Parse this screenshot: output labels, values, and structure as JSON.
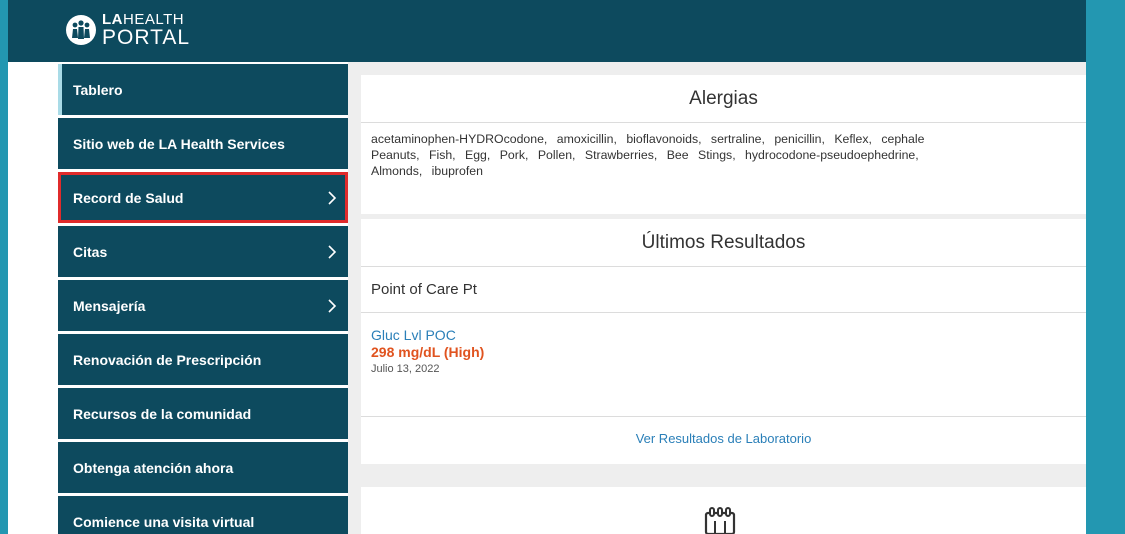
{
  "header": {
    "logo_top_bold": "LA",
    "logo_top_rest": "HEALTH",
    "logo_bottom": "PORTAL"
  },
  "sidebar": {
    "items": [
      {
        "label": "Tablero",
        "chevron": false
      },
      {
        "label": "Sitio web de LA Health Services",
        "chevron": false
      },
      {
        "label": "Record de Salud",
        "chevron": true
      },
      {
        "label": "Citas",
        "chevron": true
      },
      {
        "label": "Mensajería",
        "chevron": true
      },
      {
        "label": "Renovación de Prescripción",
        "chevron": false
      },
      {
        "label": "Recursos de la comunidad",
        "chevron": false
      },
      {
        "label": "Obtenga atención ahora",
        "chevron": false
      },
      {
        "label": "Comience una visita virtual",
        "chevron": false
      }
    ]
  },
  "allergies": {
    "title": "Alergias",
    "lines": [
      "acetaminophen-HYDROcodone, amoxicillin, bioflavonoids, sertraline, penicillin, Keflex, cephale",
      "Peanuts, Fish, Egg, Pork, Pollen, Strawberries, Bee Stings, hydrocodone-pseudoephedrine,",
      "Almonds, ibuprofen"
    ]
  },
  "results": {
    "title": "Últimos Resultados",
    "section": "Point of Care Pt",
    "item": {
      "name": "Gluc Lvl POC",
      "value": "298 mg/dL (High)",
      "date": "Julio 13, 2022"
    },
    "link": "Ver Resultados de Laboratorio"
  },
  "colors": {
    "background": "#2397b1",
    "nav": "#0d4a5e",
    "highlight": "#e02b2b",
    "link": "#2a7fb8",
    "alert": "#e0531f"
  },
  "icons": {
    "nav_chevron": "chevron-right-icon",
    "calendar": "calendar-icon",
    "logo": "family-logo-icon"
  }
}
